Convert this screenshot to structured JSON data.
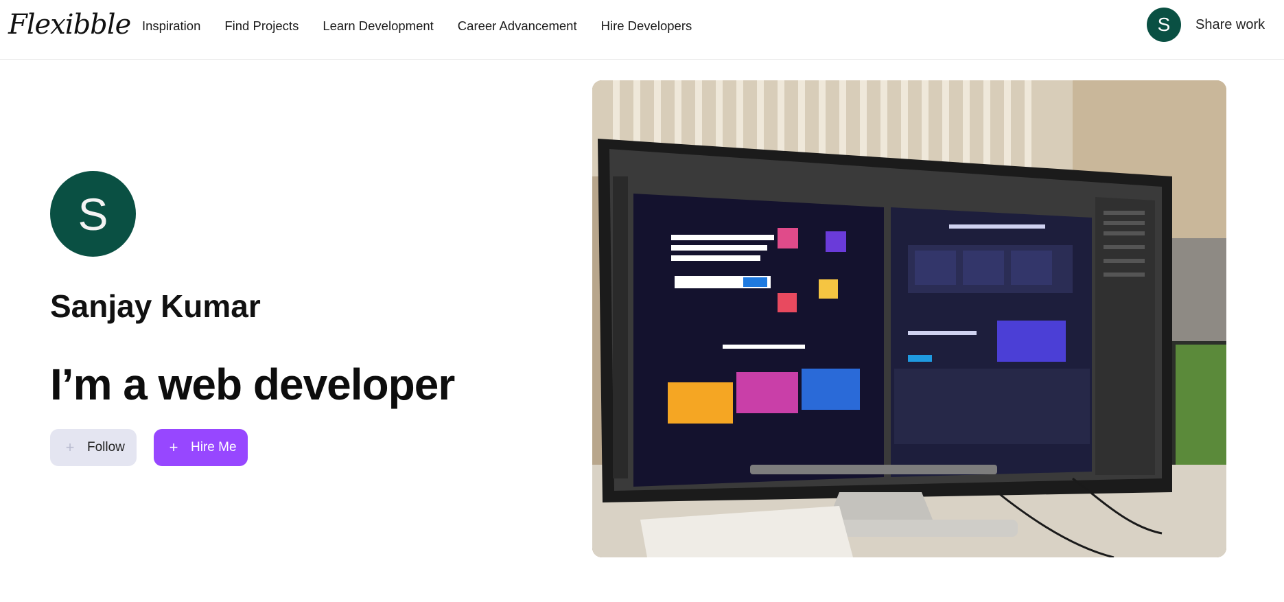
{
  "brand": {
    "logo_text": "Flexibble"
  },
  "nav": {
    "links": [
      {
        "label": "Inspiration"
      },
      {
        "label": "Find Projects"
      },
      {
        "label": "Learn Development"
      },
      {
        "label": "Career Advancement"
      },
      {
        "label": "Hire Developers"
      }
    ],
    "avatar_initial": "S",
    "share_label": "Share work"
  },
  "profile": {
    "avatar_initial": "S",
    "name": "Sanjay Kumar",
    "tagline": "I’m a web developer",
    "follow_label": "Follow",
    "hire_label": "Hire Me"
  },
  "colors": {
    "avatar_bg": "#0a5043",
    "hire_button": "#9747ff",
    "follow_button": "#e4e5f1"
  },
  "icons": {
    "follow": "plus-icon",
    "hire": "plus-icon"
  }
}
